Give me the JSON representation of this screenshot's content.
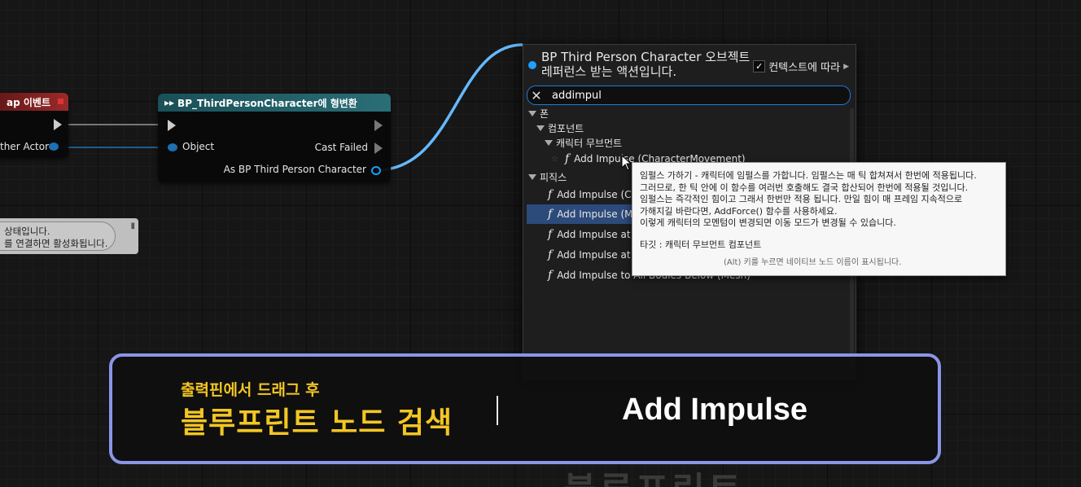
{
  "left_event_node": {
    "title": "ap 이벤트",
    "other_actor_label": "ther Actor"
  },
  "cast_node": {
    "title": "BP_ThirdPersonCharacter에 형변환",
    "object_label": "Object",
    "cast_failed_label": "Cast Failed",
    "output_label": "As BP Third Person Character"
  },
  "comment": {
    "line1": "상태입니다.",
    "line2": "를 연결하면 활성화됩니다."
  },
  "context_menu": {
    "title": "BP Third Person Character 오브젝트\n레퍼런스 받는 액션입니다.",
    "context_toggle_label": "컨텍스트에 따라",
    "context_toggle_checked": true,
    "search_value": "addimpul",
    "tree": {
      "pawn": "폰",
      "component": "컴포넌트",
      "char_movement": "캐릭터 무브먼트",
      "first_result": "Add Impulse (CharacterMovement)",
      "physics": "피직스"
    },
    "physics_results": [
      "Add Impulse (C",
      "Add Impulse (M",
      "Add Impulse at",
      "Add Impulse at",
      "Add Impulse to All Bodies Below (Mesh)"
    ],
    "selected_index": 1
  },
  "tooltip": {
    "lines": [
      "임펄스 가하기 - 캐릭터에 임펄스를 가합니다. 임펄스는 매 틱 합쳐져서 한번에 적용됩니다.",
      "그러므로, 한 틱 안에 이 함수를 여러번 호출해도 결국 합산되어 한번에 적용될 것입니다.",
      "임펄스는 즉각적인 힘이고 그래서 한번만 적용 됩니다. 만일 힘이 매 프레임 지속적으로",
      "가해지길 바란다면, AddForce() 함수를 사용하세요.",
      "이렇게 캐릭터의 모멘텀이 변경되면 이동 모드가 변경될 수 있습니다."
    ],
    "target": "타깃 : 캐릭터 무브먼트 컴포넌트",
    "hint": "(Alt) 키를 누르면 네이티브 노드 이름이 표시됩니다."
  },
  "caption": {
    "subtitle": "출력핀에서 드래그 후",
    "title": "블루프린트 노드 검색",
    "keyword": "Add Impulse"
  },
  "watermark": "블루프린트",
  "colors": {
    "cast_header": "#1f5f66",
    "event_header": "#8a1f1f",
    "object_pin": "#1e9cf0",
    "selection": "#2c4a7a",
    "caption_border": "#8a95e8",
    "caption_gold": "#f3c623"
  }
}
